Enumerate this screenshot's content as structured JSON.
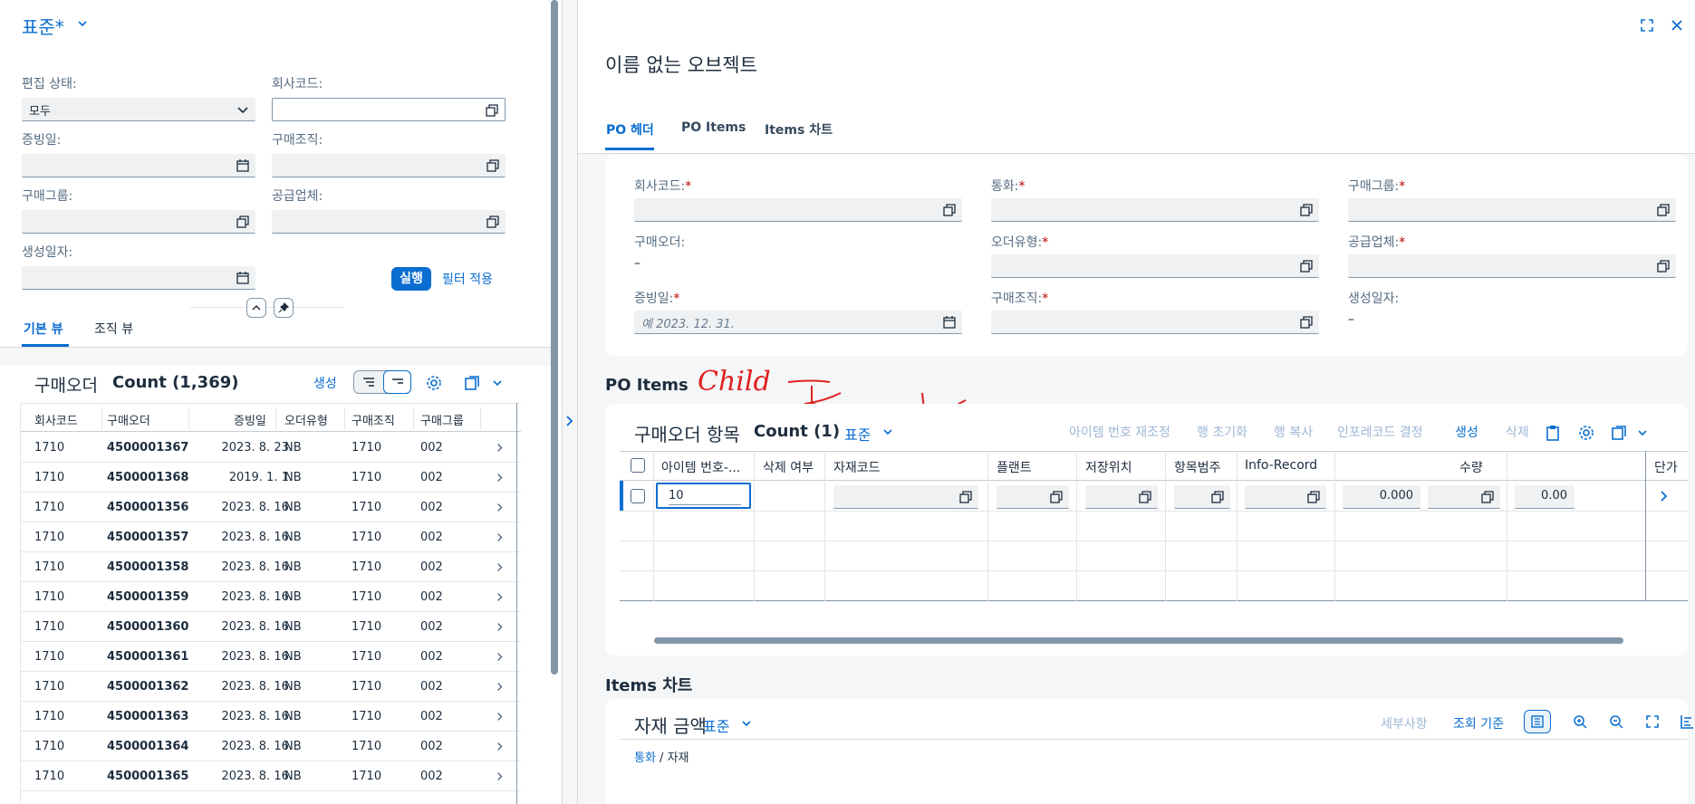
{
  "left": {
    "variant": "표준*",
    "filters": {
      "edit_status_label": "편집 상태:",
      "edit_status_value": "모두",
      "company_code_label": "회사코드:",
      "doc_date_label": "증빙일:",
      "purch_org_label": "구매조직:",
      "purch_group_label": "구매그룹:",
      "supplier_label": "공급업체:",
      "created_date_label": "생성일자:"
    },
    "go_label": "실행",
    "adapt_filters_label": "필터 적용",
    "tabs": [
      "기본 뷰",
      "조직 뷰"
    ],
    "table": {
      "title": "구매오더",
      "count": "Count (1,369)",
      "create_label": "생성",
      "columns": [
        "회사코드",
        "구매오더",
        "증빙일",
        "오더유형",
        "구매조직",
        "구매그룹"
      ],
      "rows": [
        [
          "1710",
          "4500001367",
          "2023. 8. 23.",
          "NB",
          "1710",
          "002"
        ],
        [
          "1710",
          "4500001368",
          "2019. 1. 1.",
          "NB",
          "1710",
          "002"
        ],
        [
          "1710",
          "4500001356",
          "2023. 8. 16.",
          "NB",
          "1710",
          "002"
        ],
        [
          "1710",
          "4500001357",
          "2023. 8. 16.",
          "NB",
          "1710",
          "002"
        ],
        [
          "1710",
          "4500001358",
          "2023. 8. 16.",
          "NB",
          "1710",
          "002"
        ],
        [
          "1710",
          "4500001359",
          "2023. 8. 16.",
          "NB",
          "1710",
          "002"
        ],
        [
          "1710",
          "4500001360",
          "2023. 8. 16.",
          "NB",
          "1710",
          "002"
        ],
        [
          "1710",
          "4500001361",
          "2023. 8. 16.",
          "NB",
          "1710",
          "002"
        ],
        [
          "1710",
          "4500001362",
          "2023. 8. 16.",
          "NB",
          "1710",
          "002"
        ],
        [
          "1710",
          "4500001363",
          "2023. 8. 16.",
          "NB",
          "1710",
          "002"
        ],
        [
          "1710",
          "4500001364",
          "2023. 8. 16.",
          "NB",
          "1710",
          "002"
        ],
        [
          "1710",
          "4500001365",
          "2023. 8. 16.",
          "NB",
          "1710",
          "002"
        ]
      ]
    }
  },
  "right": {
    "object_title": "이름 없는 오브젝트",
    "tabs": [
      "PO 헤더",
      "PO Items",
      "Items 차트"
    ],
    "header_form": {
      "company_code": "회사코드:",
      "currency": "통화:",
      "purch_group": "구매그룹:",
      "purchase_order": "구매오더:",
      "purchase_order_value": "–",
      "order_type": "오더유형:",
      "supplier": "공급업체:",
      "doc_date": "증빙일:",
      "doc_date_placeholder": "예 2023. 12. 31.",
      "purch_org": "구매조직:",
      "created_date": "생성일자:",
      "created_date_value": "–",
      "required_mark": "*"
    },
    "po_items": {
      "section_title": "PO Items",
      "handwritten": "Child",
      "table_title": "구매오더 항목",
      "count": "Count (1)",
      "variant": "표준",
      "toolbar": [
        "아이템 번호 재조정",
        "행 초기화",
        "행 복사",
        "인포레코드 결정",
        "생성",
        "삭제"
      ],
      "columns": [
        "아이템 번호-...",
        "삭제 여부",
        "자재코드",
        "플랜트",
        "저장위치",
        "항목범주",
        "Info-Record",
        "수량",
        "단가"
      ],
      "row": {
        "item_no": "10",
        "quantity": "0.000",
        "price": "0.00"
      }
    },
    "items_chart": {
      "section_title": "Items 차트",
      "chart_title": "자재 금액",
      "variant": "표준",
      "details_label": "세부사항",
      "view_by_label": "조회 기준",
      "breadcrumb_link": "통화",
      "breadcrumb_sep": " / ",
      "breadcrumb_current": "자재"
    }
  },
  "colors": {
    "accent": "#0a6ed1",
    "text": "#1d2d3e",
    "required": "#bb0000",
    "handwriting": "#e02020"
  }
}
